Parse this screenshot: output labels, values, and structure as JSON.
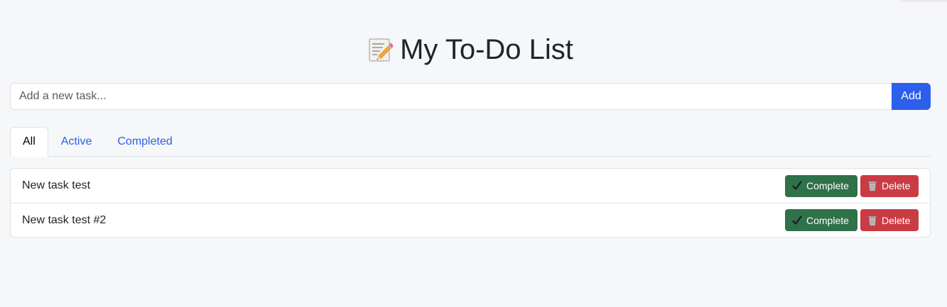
{
  "header": {
    "title": "My To-Do List",
    "title_icon": "memo-pencil-icon"
  },
  "task_input": {
    "placeholder": "Add a new task...",
    "value": ""
  },
  "add_button": {
    "label": "Add"
  },
  "tabs": [
    {
      "label": "All",
      "active": true
    },
    {
      "label": "Active",
      "active": false
    },
    {
      "label": "Completed",
      "active": false
    }
  ],
  "tasks": [
    {
      "text": "New task test",
      "complete_label": "Complete",
      "delete_label": "Delete"
    },
    {
      "text": "New task test #2",
      "complete_label": "Complete",
      "delete_label": "Delete"
    }
  ],
  "icons": {
    "complete": "check-icon",
    "delete": "trash-icon"
  },
  "colors": {
    "primary": "#2b5fec",
    "success": "#2f7149",
    "danger": "#ca3c44",
    "background": "#f6f7f9"
  }
}
